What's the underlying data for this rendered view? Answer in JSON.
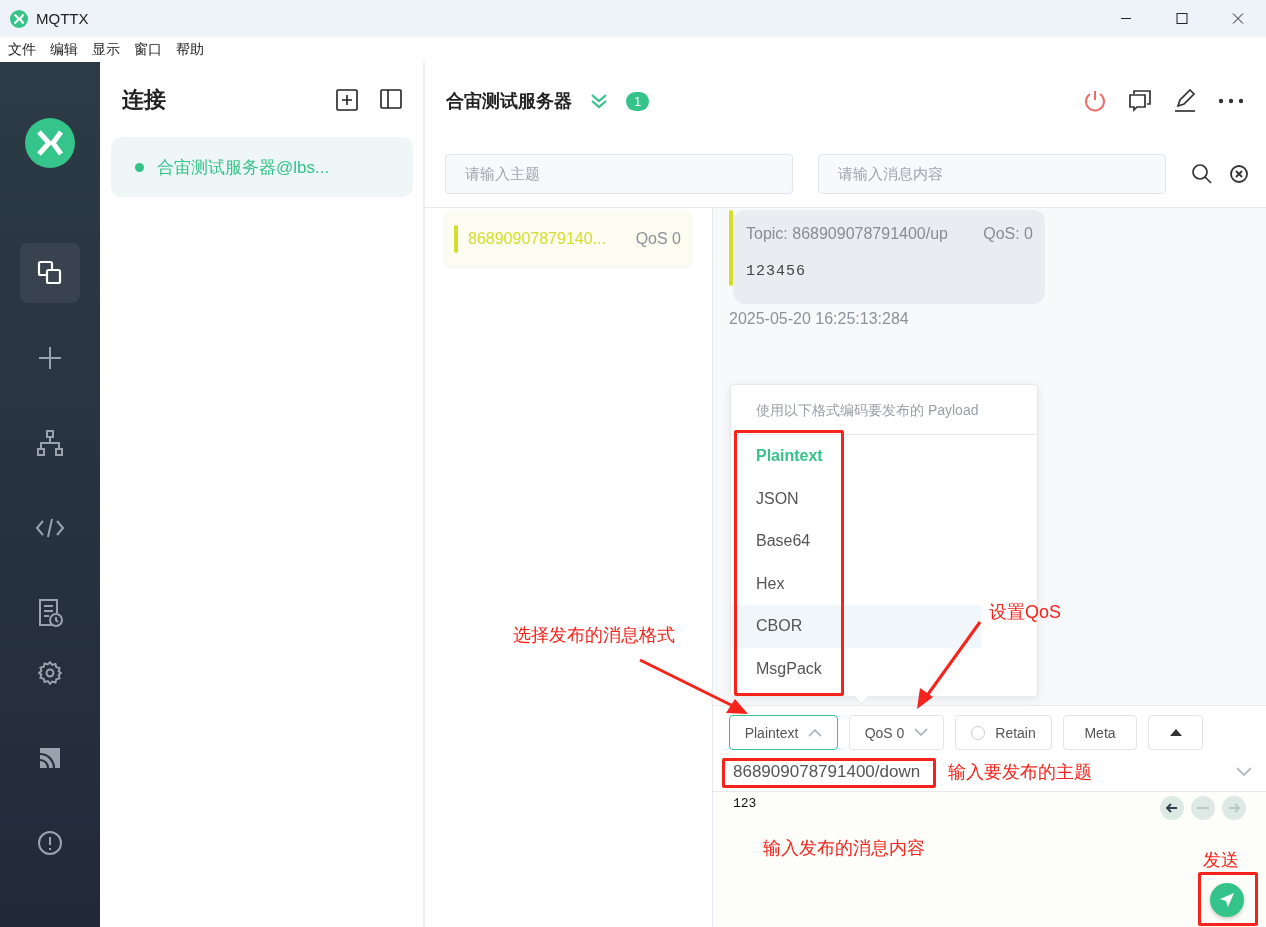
{
  "window": {
    "title": "MQTTX"
  },
  "menu": [
    "文件",
    "编辑",
    "显示",
    "窗口",
    "帮助"
  ],
  "nav": [
    {
      "kind": "connections",
      "selected": true
    },
    {
      "kind": "new",
      "selected": false
    },
    {
      "kind": "topology",
      "selected": false
    },
    {
      "kind": "script",
      "selected": false
    },
    {
      "kind": "log",
      "selected": false
    },
    {
      "kind": "settings",
      "selected": false
    },
    {
      "kind": "feed",
      "selected": false
    },
    {
      "kind": "about",
      "selected": false
    }
  ],
  "connections": {
    "title": "连接",
    "items": [
      {
        "name": "合宙测试服务器@lbs...",
        "connected": true,
        "selected": true
      }
    ]
  },
  "header": {
    "title": "合宙测试服务器",
    "badge": "1"
  },
  "search": {
    "topic_placeholder": "请输入主题",
    "payload_placeholder": "请输入消息内容"
  },
  "topics": [
    {
      "topic": "86890907879140...",
      "qos": "QoS 0",
      "color": "#d4dd2c"
    }
  ],
  "messages": [
    {
      "topic": "Topic: 868909078791400/up",
      "qos": "QoS: 0",
      "payload": "123456",
      "time": "2025-05-20 16:25:13:284",
      "color": "#d4dd2c"
    }
  ],
  "format_menu": {
    "hint": "使用以下格式编码要发布的 Payload",
    "options": [
      {
        "label": "Plaintext",
        "selected": true,
        "hovered": false
      },
      {
        "label": "JSON",
        "selected": false,
        "hovered": false
      },
      {
        "label": "Base64",
        "selected": false,
        "hovered": false
      },
      {
        "label": "Hex",
        "selected": false,
        "hovered": false
      },
      {
        "label": "CBOR",
        "selected": false,
        "hovered": true
      },
      {
        "label": "MsgPack",
        "selected": false,
        "hovered": false
      }
    ]
  },
  "publish": {
    "format": "Plaintext",
    "qos": "QoS 0",
    "retain": {
      "label": "Retain",
      "checked": false
    },
    "meta": "Meta",
    "topic": "868909078791400/down",
    "payload": "123"
  },
  "annotations": [
    "选择发布的消息格式",
    "设置QoS",
    "输入要发布的主题",
    "输入发布的消息内容",
    "发送"
  ]
}
